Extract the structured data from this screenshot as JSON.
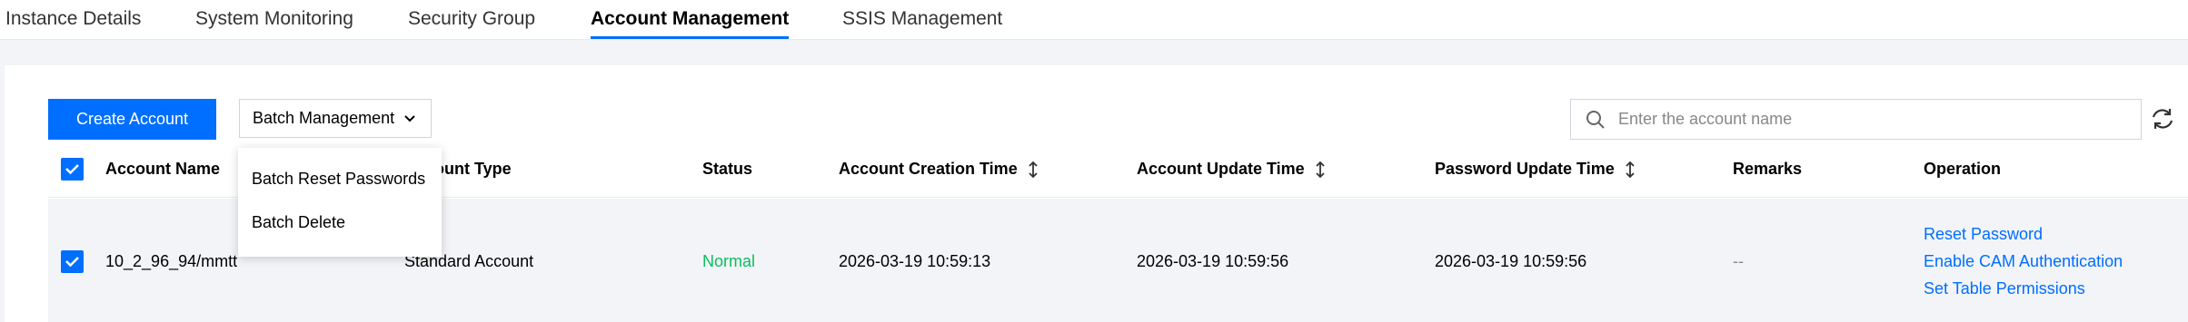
{
  "tabs": [
    {
      "label": "Instance Details"
    },
    {
      "label": "System Monitoring"
    },
    {
      "label": "Security Group"
    },
    {
      "label": "Account Management",
      "active": true
    },
    {
      "label": "SSIS Management"
    }
  ],
  "toolbar": {
    "create_label": "Create Account",
    "batch_label": "Batch Management",
    "search_placeholder": "Enter the account name"
  },
  "table": {
    "columns": [
      "Account Name",
      "Account Type",
      "Status",
      "Account Creation Time",
      "Account Update Time",
      "Password Update Time",
      "Remarks",
      "Operation"
    ],
    "rows": [
      {
        "checked": true,
        "account_name": "10_2_96_94/mmtt",
        "account_type": "Standard Account",
        "status": "Normal",
        "created": "2026-03-19 10:59:13",
        "updated": "2026-03-19 10:59:56",
        "password_updated": "2026-03-19 10:59:56",
        "remarks": "--",
        "operations": [
          "Reset Password",
          "Enable CAM Authentication",
          "Set Table Permissions"
        ]
      }
    ]
  },
  "dropdown": {
    "items": [
      "Batch Reset Passwords",
      "Batch Delete"
    ]
  },
  "colors": {
    "primary": "#006eff",
    "status_normal": "#0abf5b"
  }
}
